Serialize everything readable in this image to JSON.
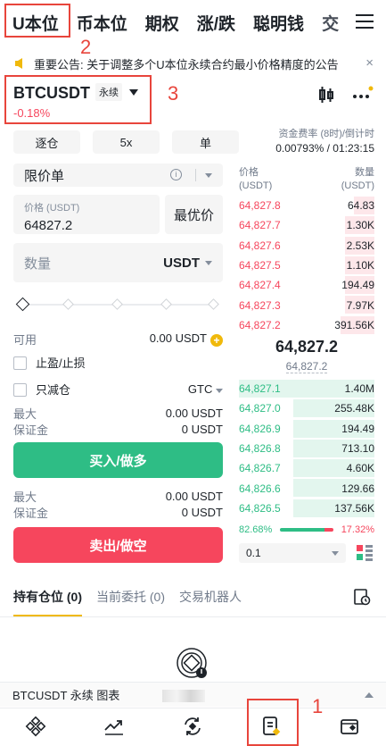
{
  "top_tabs": [
    "U本位",
    "币本位",
    "期权",
    "涨/跌",
    "聪明钱",
    "交易"
  ],
  "annotations": [
    "1",
    "2",
    "3"
  ],
  "notice": {
    "text": "重要公告: 关于调整多个U本位永续合约最小价格精度的公告",
    "close": "×"
  },
  "symbol": {
    "name": "BTCUSDT",
    "tag": "永续",
    "change": "-0.18%"
  },
  "funding": {
    "label": "资金费率 (8时)/倒计时",
    "value": "0.00793% / 01:23:15"
  },
  "form": {
    "margin_mode": "逐仓",
    "leverage": "5x",
    "position_mode": "单",
    "order_type": "限价单",
    "price_label": "价格 (USDT)",
    "price_value": "64827.2",
    "best_price": "最优价",
    "qty_placeholder": "数量",
    "qty_unit": "USDT",
    "available_label": "可用",
    "available_value": "0.00 USDT",
    "tpsl_label": "止盈/止损",
    "reduce_only_label": "只减仓",
    "tif": "GTC",
    "buy": {
      "max_label": "最大",
      "max_value": "0.00 USDT",
      "margin_label": "保证金",
      "margin_value": "0 USDT",
      "button": "买入/做多"
    },
    "sell": {
      "max_label": "最大",
      "max_value": "0.00 USDT",
      "margin_label": "保证金",
      "margin_value": "0 USDT",
      "button": "卖出/做空"
    }
  },
  "orderbook": {
    "price_col": "价格",
    "price_unit": "(USDT)",
    "qty_col": "数量",
    "qty_unit": "(USDT)",
    "asks": [
      {
        "price": "64,827.8",
        "qty": "64.83",
        "depth": 0.15
      },
      {
        "price": "64,827.7",
        "qty": "1.30K",
        "depth": 0.22
      },
      {
        "price": "64,827.6",
        "qty": "2.53K",
        "depth": 0.22
      },
      {
        "price": "64,827.5",
        "qty": "1.10K",
        "depth": 0.22
      },
      {
        "price": "64,827.4",
        "qty": "194.49",
        "depth": 0.22
      },
      {
        "price": "64,827.3",
        "qty": "7.97K",
        "depth": 0.22
      },
      {
        "price": "64,827.2",
        "qty": "391.56K",
        "depth": 0.25
      }
    ],
    "last_price": "64,827.2",
    "mark_price": "64,827.2",
    "bids": [
      {
        "price": "64,827.1",
        "qty": "1.40M",
        "depth": 1.0
      },
      {
        "price": "64,827.0",
        "qty": "255.48K",
        "depth": 0.6
      },
      {
        "price": "64,826.9",
        "qty": "194.49",
        "depth": 0.6
      },
      {
        "price": "64,826.8",
        "qty": "713.10",
        "depth": 0.6
      },
      {
        "price": "64,826.7",
        "qty": "4.60K",
        "depth": 0.6
      },
      {
        "price": "64,826.6",
        "qty": "129.66",
        "depth": 0.6
      },
      {
        "price": "64,826.5",
        "qty": "137.56K",
        "depth": 0.6
      }
    ],
    "buy_ratio": "82.68%",
    "sell_ratio": "17.32%",
    "buy_ratio_value": 0.8268,
    "depth_step": "0.1"
  },
  "bottom_tabs": [
    "持有仓位 (0)",
    "当前委托 (0)",
    "交易机器人"
  ],
  "chart_bar": "BTCUSDT 永续 图表",
  "colors": {
    "brand": "#f0b90b",
    "buy": "#2ebd85",
    "sell": "#f6465d",
    "annotation": "#e8453c"
  }
}
